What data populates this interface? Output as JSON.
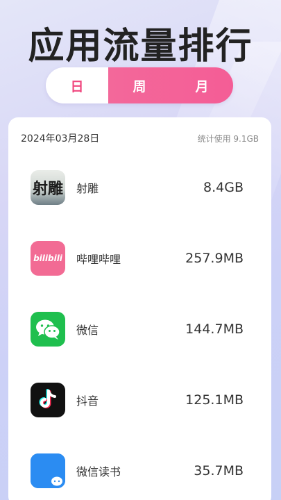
{
  "page_title": "应用流量排行",
  "tabs": {
    "day": "日",
    "week": "周",
    "month": "月"
  },
  "summary": {
    "date": "2024年03月28日",
    "total": "统计使用 9.1GB"
  },
  "apps": [
    {
      "name": "射雕",
      "value": "8.4GB",
      "icon": "shediao-game-icon"
    },
    {
      "name": "哔哩哔哩",
      "value": "257.9MB",
      "icon": "bilibili-icon"
    },
    {
      "name": "微信",
      "value": "144.7MB",
      "icon": "wechat-icon"
    },
    {
      "name": "抖音",
      "value": "125.1MB",
      "icon": "douyin-icon"
    },
    {
      "name": "微信读书",
      "value": "35.7MB",
      "icon": "wechat-read-icon"
    }
  ],
  "icon_text": {
    "shediao": "射雕",
    "bilibili": "bilibili"
  },
  "colors": {
    "accent": "#f3689a",
    "wechat": "#1fbf4e",
    "read": "#2b8cf2"
  }
}
